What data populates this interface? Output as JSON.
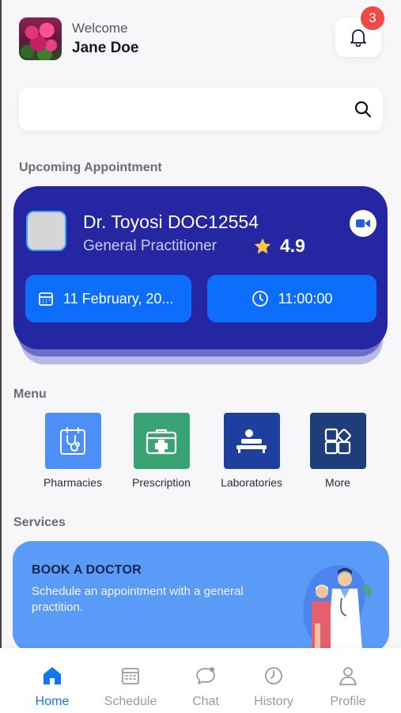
{
  "header": {
    "welcome": "Welcome",
    "user_name": "Jane Doe",
    "notification_count": "3"
  },
  "search": {
    "placeholder": ""
  },
  "sections": {
    "upcoming": "Upcoming Appointment",
    "menu": "Menu",
    "services": "Services"
  },
  "appointment": {
    "doctor_name": "Dr. Toyosi DOC12554",
    "specialty": "General Practitioner",
    "rating": "4.9",
    "date": "11 February, 20...",
    "time": "11:00:00"
  },
  "menu": [
    {
      "label": "Pharmacies",
      "color": "#4e8ef7",
      "icon": "stethoscope-clipboard-icon"
    },
    {
      "label": "Prescription",
      "color": "#3aa373",
      "icon": "medical-kit-icon"
    },
    {
      "label": "Laboratories",
      "color": "#1f3f9e",
      "icon": "lab-bed-icon"
    },
    {
      "label": "More",
      "color": "#1d3e7a",
      "icon": "grid-more-icon"
    }
  ],
  "banner": {
    "title": "BOOK A DOCTOR",
    "text": "Schedule an appointment with a general practition."
  },
  "nav": [
    {
      "label": "Home",
      "icon": "home-icon",
      "active": true
    },
    {
      "label": "Schedule",
      "icon": "calendar-icon",
      "active": false
    },
    {
      "label": "Chat",
      "icon": "chat-icon",
      "active": false
    },
    {
      "label": "History",
      "icon": "clock-history-icon",
      "active": false
    },
    {
      "label": "Profile",
      "icon": "user-icon",
      "active": false
    }
  ],
  "colors": {
    "card_bg": "#2526a2",
    "accent_blue": "#0d6efd",
    "badge_red": "#f04a45",
    "star": "#f6c64a",
    "nav_active": "#1477f2"
  }
}
